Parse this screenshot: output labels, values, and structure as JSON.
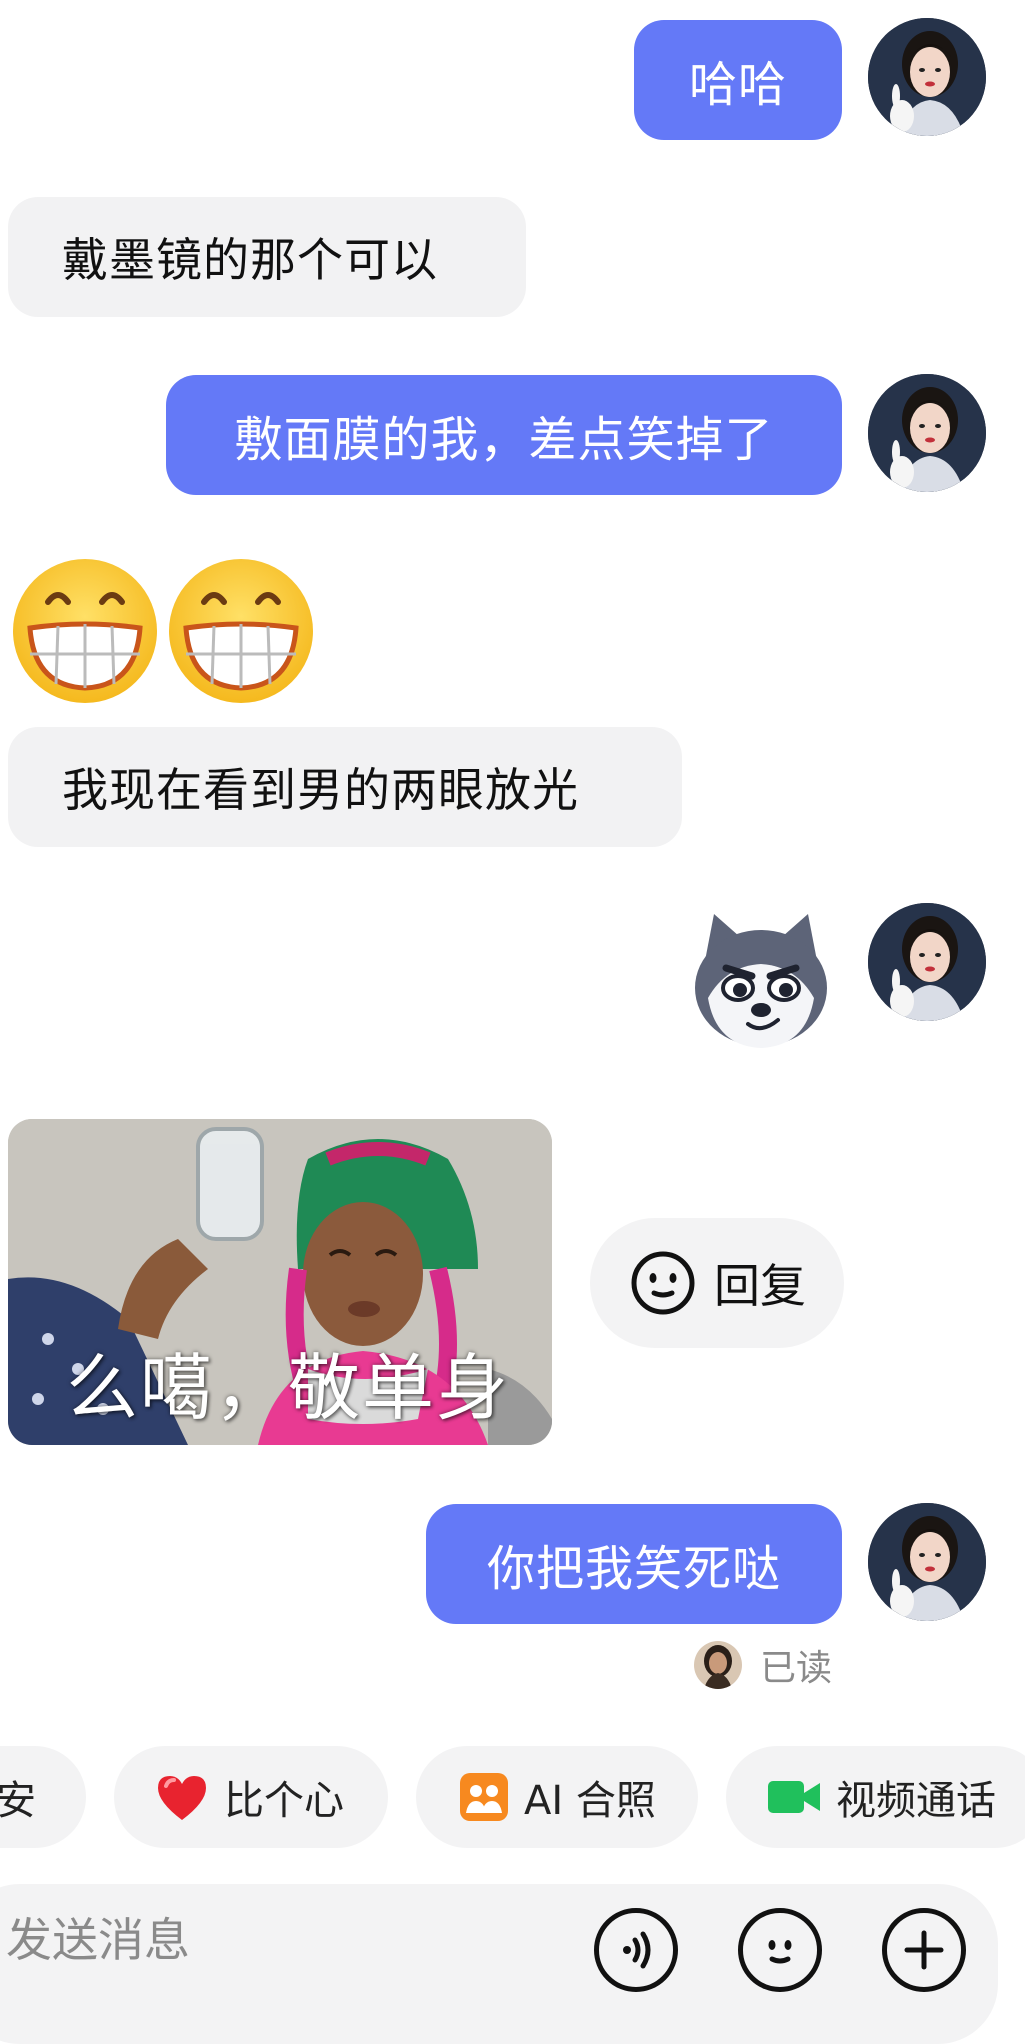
{
  "messages": [
    {
      "id": "m1",
      "sender": "me",
      "text": "哈哈"
    },
    {
      "id": "m2",
      "sender": "them",
      "text": "戴墨镜的那个可以"
    },
    {
      "id": "m3",
      "sender": "me",
      "text": "敷面膜的我，差点笑掉了"
    },
    {
      "id": "m4",
      "sender": "them",
      "type": "emoji",
      "emoji": "grinning-face-icon ×2"
    },
    {
      "id": "m5",
      "sender": "them",
      "text": "我现在看到男的两眼放光"
    },
    {
      "id": "m6",
      "sender": "me",
      "type": "sticker",
      "sticker": "husky-dog-sticker"
    },
    {
      "id": "m7",
      "sender": "them",
      "type": "image",
      "caption": "么噶，敬单身"
    },
    {
      "id": "m8",
      "sender": "me",
      "text": "你把我笑死哒"
    }
  ],
  "reply_button": {
    "label": "回复"
  },
  "read_status": {
    "label": "已读"
  },
  "quick_actions": [
    {
      "label": "晚安",
      "icon": "none"
    },
    {
      "label": "比个心",
      "icon": "heart-icon"
    },
    {
      "label": "AI 合照",
      "icon": "ai-photo-icon"
    },
    {
      "label": "视频通话",
      "icon": "video-camera-icon"
    }
  ],
  "input": {
    "placeholder": "发送消息"
  },
  "colors": {
    "accent": "#6479f7",
    "bubble_them": "#f2f2f3",
    "video_green": "#20c05c",
    "ai_orange": "#f7891f",
    "heart_red": "#e8232f"
  }
}
